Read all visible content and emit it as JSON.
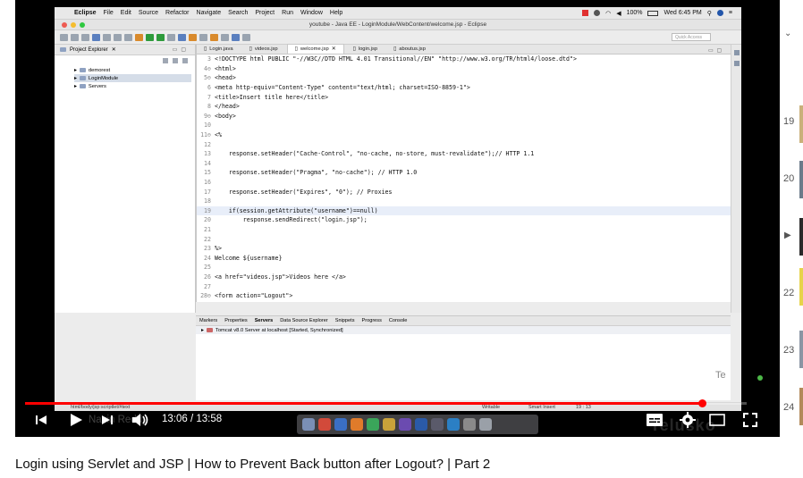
{
  "menubar": {
    "app": "Eclipse",
    "items": [
      "File",
      "Edit",
      "Source",
      "Refactor",
      "Navigate",
      "Search",
      "Project",
      "Run",
      "Window",
      "Help"
    ],
    "battery": "100%",
    "clock": "Wed 6:45 PM"
  },
  "window": {
    "title": "youtube - Java EE - LoginModule/WebContent/welcome.jsp - Eclipse",
    "quick_access_placeholder": "Quick Access"
  },
  "explorer": {
    "title": "Project Explorer",
    "items": [
      {
        "label": "demorest"
      },
      {
        "label": "LoginModule"
      },
      {
        "label": "Servers"
      }
    ]
  },
  "editor": {
    "tabs": [
      "Login.java",
      "videos.jsp",
      "welcome.jsp",
      "login.jsp",
      "aboutus.jsp"
    ],
    "active_tab": "welcome.jsp",
    "lines": [
      {
        "n": "3",
        "text": "<!DOCTYPE html PUBLIC \"-//W3C//DTD HTML 4.01 Transitional//EN\" \"http://www.w3.org/TR/html4/loose.dtd\">"
      },
      {
        "n": "4⊖",
        "text": "<html>"
      },
      {
        "n": "5⊖",
        "text": "<head>"
      },
      {
        "n": "6",
        "text": "<meta http-equiv=\"Content-Type\" content=\"text/html; charset=ISO-8859-1\">"
      },
      {
        "n": "7",
        "text": "<title>Insert title here</title>"
      },
      {
        "n": "8",
        "text": "</head>"
      },
      {
        "n": "9⊖",
        "text": "<body>"
      },
      {
        "n": "10",
        "text": ""
      },
      {
        "n": "11⊖",
        "text": "<%"
      },
      {
        "n": "12",
        "text": ""
      },
      {
        "n": "13",
        "text": "    response.setHeader(\"Cache-Control\", \"no-cache, no-store, must-revalidate\");// HTTP 1.1"
      },
      {
        "n": "14",
        "text": ""
      },
      {
        "n": "15",
        "text": "    response.setHeader(\"Pragma\", \"no-cache\"); // HTTP 1.0"
      },
      {
        "n": "16",
        "text": ""
      },
      {
        "n": "17",
        "text": "    response.setHeader(\"Expires\", \"0\"); // Proxies"
      },
      {
        "n": "18",
        "text": ""
      },
      {
        "n": "19",
        "text": "    if(session.getAttribute(\"username\")==null)"
      },
      {
        "n": "20",
        "text": "        response.sendRedirect(\"login.jsp\");"
      },
      {
        "n": "21",
        "text": ""
      },
      {
        "n": "22",
        "text": ""
      },
      {
        "n": "23",
        "text": "%>"
      },
      {
        "n": "24",
        "text": "Welcome ${username}"
      },
      {
        "n": "25",
        "text": ""
      },
      {
        "n": "26",
        "text": "<a href=\"videos.jsp\">Videos here </a>"
      },
      {
        "n": "27",
        "text": ""
      },
      {
        "n": "28⊖",
        "text": "<form action=\"Logout\">"
      }
    ]
  },
  "servers_view": {
    "tabs": [
      "Markers",
      "Properties",
      "Servers",
      "Data Source Explorer",
      "Snippets",
      "Progress",
      "Console"
    ],
    "active_tab": "Servers",
    "row": "Tomcat v8.0 Server at localhost  [Started, Synchronized]"
  },
  "statusbar": {
    "path": "html/body/jsp:scriptlet/#text",
    "mode": "Writable",
    "insert": "Smart Insert",
    "position": "19 : 13"
  },
  "overlay": {
    "name": "Navin Reddy",
    "watermark": "Telusko",
    "corner_text": "Te"
  },
  "player": {
    "current_time": "13:06",
    "duration": "13:58",
    "progress": 0.938
  },
  "up_next": {
    "numbers": [
      "19",
      "20",
      "22",
      "23",
      "24"
    ]
  },
  "video": {
    "title": "Login using Servlet and JSP | How to Prevent Back button after Logout? | Part 2"
  }
}
